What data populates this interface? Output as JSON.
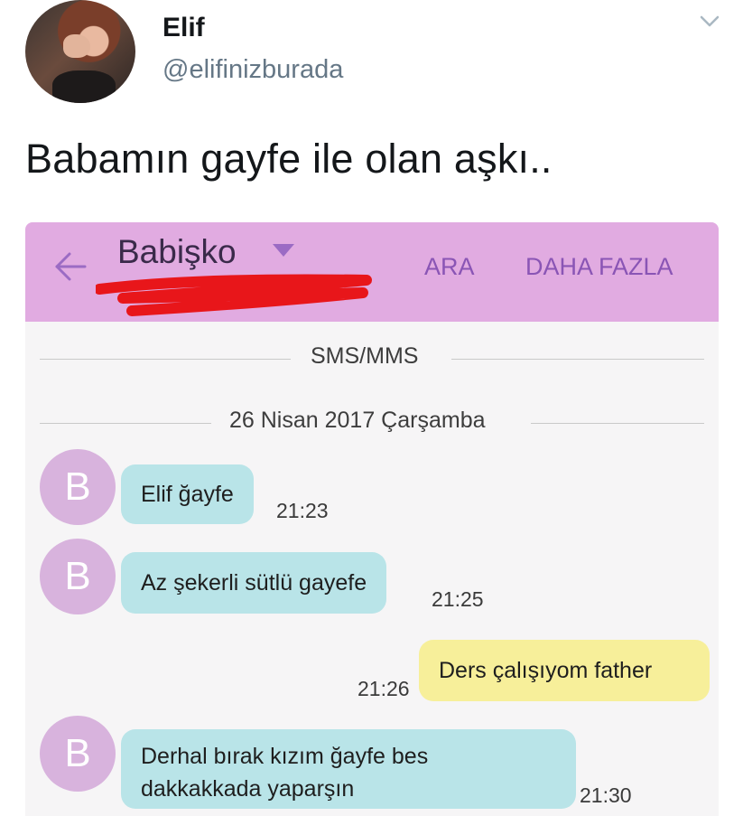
{
  "tweet": {
    "display_name": "Elif",
    "handle": "@elifinizburada",
    "text": "Babamın gayfe ile olan aşkı.."
  },
  "sms": {
    "contact_name": "Babişko",
    "actions": {
      "call_label": "ARA",
      "more_label": "DAHA FAZLA"
    },
    "section_label": "SMS/MMS",
    "date_label": "26 Nisan 2017 Çarşamba",
    "contact_initial": "B",
    "messages": [
      {
        "direction": "incoming",
        "text": "Elif ğayfe",
        "time": "21:23"
      },
      {
        "direction": "incoming",
        "text": "Az şekerli sütlü gayefe",
        "time": "21:25"
      },
      {
        "direction": "outgoing",
        "text": "Ders çalışıyom father",
        "time": "21:26"
      },
      {
        "direction": "incoming",
        "lines": [
          "Derhal  bırak kızım ğayfe bes",
          "dakkakkada yaparşın"
        ],
        "time": "21:30"
      }
    ]
  },
  "colors": {
    "sms_topbar": "#e1abe1",
    "incoming_bubble": "#b9e4e8",
    "outgoing_bubble": "#f7ef9a",
    "contact_avatar": "#d8b3dd",
    "action_text": "#8a55b5",
    "redaction_mark": "#e8161a"
  },
  "icons": {
    "tweet_menu": "chevron-down-icon",
    "back": "back-arrow-icon",
    "contact_menu": "caret-down-icon"
  }
}
